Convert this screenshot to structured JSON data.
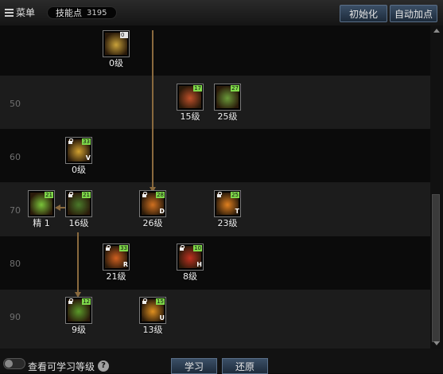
{
  "header": {
    "menu_label": "菜单",
    "skill_points_label": "技能点",
    "skill_points_value": "3195",
    "init_button": "初始化",
    "auto_button": "自动加点"
  },
  "levels": [
    "50",
    "60",
    "70",
    "80",
    "90"
  ],
  "skills": [
    {
      "id": "s1",
      "level_text": "0级",
      "badge": "0",
      "badge_style": "white",
      "locked": false,
      "key": "",
      "icon": "claw-slash-icon",
      "art_color": "#c9a23a"
    },
    {
      "id": "s2",
      "level_text": "15级",
      "badge": "17",
      "badge_style": "green",
      "locked": false,
      "key": "",
      "icon": "cat-summon-icon",
      "art_color": "#c0502a"
    },
    {
      "id": "s3",
      "level_text": "25级",
      "badge": "27",
      "badge_style": "green",
      "locked": false,
      "key": "",
      "icon": "green-spirits-icon",
      "art_color": "#6a9a3a"
    },
    {
      "id": "s4",
      "level_text": "0级",
      "badge": "33",
      "badge_style": "green",
      "locked": true,
      "key": "V",
      "icon": "broom-icon",
      "art_color": "#d0a030"
    },
    {
      "id": "s5",
      "level_text": "精 1",
      "badge": "21",
      "badge_style": "green",
      "locked": false,
      "key": "",
      "icon": "skull-trio-icon",
      "art_color": "#7ac43a"
    },
    {
      "id": "s6",
      "level_text": "16级",
      "badge": "21",
      "badge_style": "green",
      "locked": true,
      "key": "",
      "icon": "green-vortex-icon",
      "art_color": "#4a7a2a"
    },
    {
      "id": "s7",
      "level_text": "26级",
      "badge": "28",
      "badge_style": "green",
      "locked": true,
      "key": "D",
      "icon": "fire-burst-icon",
      "art_color": "#d07020"
    },
    {
      "id": "s8",
      "level_text": "23级",
      "badge": "25",
      "badge_style": "green",
      "locked": true,
      "key": "T",
      "icon": "pumpkin-icon",
      "art_color": "#e08020"
    },
    {
      "id": "s9",
      "level_text": "21级",
      "badge": "33",
      "badge_style": "green",
      "locked": true,
      "key": "R",
      "icon": "fire-eye-icon",
      "art_color": "#d06020"
    },
    {
      "id": "s10",
      "level_text": "8级",
      "badge": "10",
      "badge_style": "green",
      "locked": true,
      "key": "H",
      "icon": "fire-ring-icon",
      "art_color": "#c03020"
    },
    {
      "id": "s11",
      "level_text": "9级",
      "badge": "12",
      "badge_style": "green",
      "locked": true,
      "key": "",
      "icon": "green-slash-icon",
      "art_color": "#5a9a2a"
    },
    {
      "id": "s12",
      "level_text": "13级",
      "badge": "15",
      "badge_style": "green",
      "locked": true,
      "key": "U",
      "icon": "jack-o-lantern-icon",
      "art_color": "#e09020"
    }
  ],
  "footer": {
    "view_label": "查看可学习等级",
    "help_icon": "?",
    "learn_button": "学习",
    "restore_button": "还原"
  }
}
